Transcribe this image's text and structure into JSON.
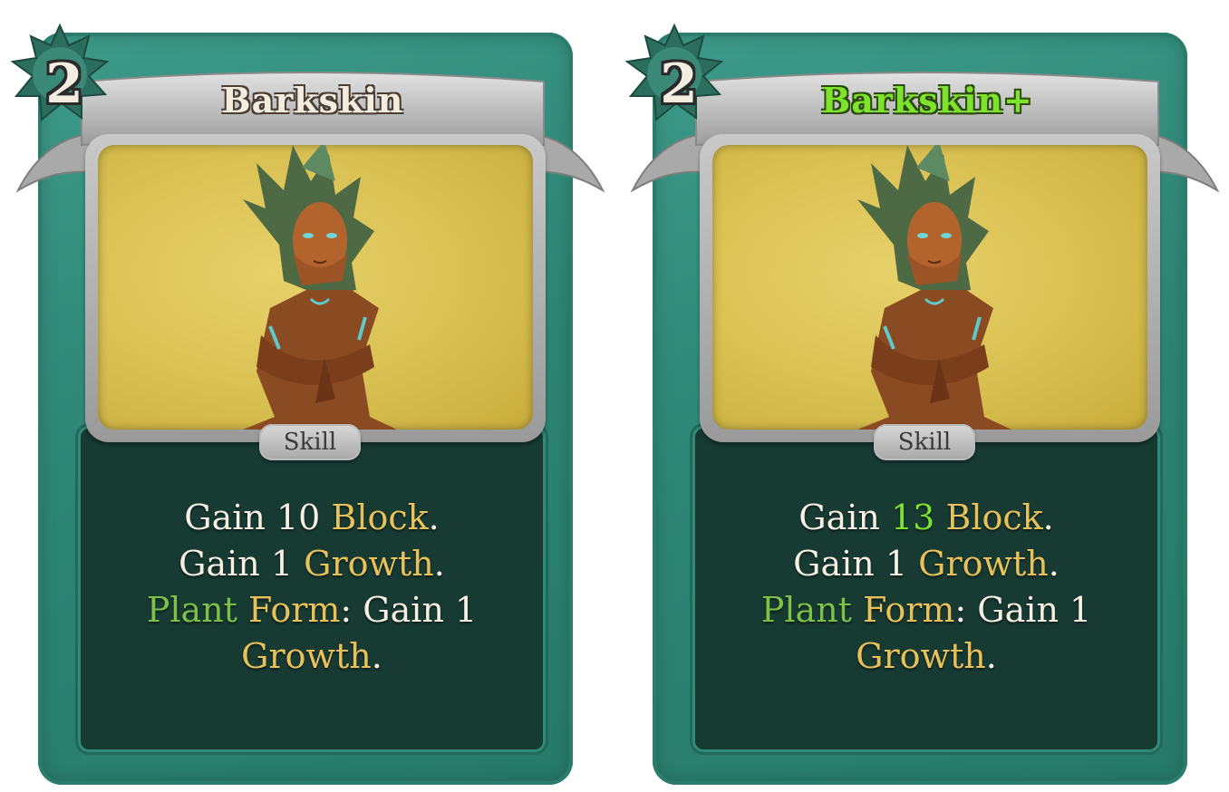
{
  "colors": {
    "frame": "#2d8574",
    "panel": "#173a32",
    "art_background": "#d9c052",
    "keyword_gold": "#e8c15a",
    "keyword_green": "#7cc248",
    "upgrade_green": "#7ee32c"
  },
  "cards": [
    {
      "cost": "2",
      "title": "Barkskin",
      "type": "Skill",
      "description": {
        "line1": {
          "word1": "Gain 10 ",
          "block": "Block",
          "end": "."
        },
        "line2": {
          "word1": "Gain 1 ",
          "growth": "Growth",
          "end": "."
        },
        "line3": {
          "plant": "Plant",
          "space": " ",
          "form": "Form",
          "rest": ": Gain 1"
        },
        "line4": {
          "growth": "Growth",
          "end": "."
        }
      }
    },
    {
      "cost": "2",
      "title": "Barkskin+",
      "type": "Skill",
      "description": {
        "line1": {
          "word1": "Gain ",
          "value": "13",
          "space": " ",
          "block": "Block",
          "end": "."
        },
        "line2": {
          "word1": "Gain 1 ",
          "growth": "Growth",
          "end": "."
        },
        "line3": {
          "plant": "Plant",
          "space": " ",
          "form": "Form",
          "rest": ": Gain 1"
        },
        "line4": {
          "growth": "Growth",
          "end": "."
        }
      }
    }
  ]
}
